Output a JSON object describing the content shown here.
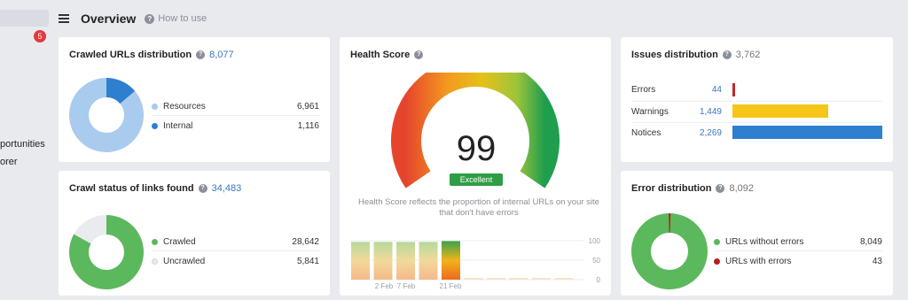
{
  "sidebar": {
    "badge": "5",
    "items": [
      {
        "label": "portunities"
      },
      {
        "label": "orer"
      }
    ]
  },
  "header": {
    "title": "Overview",
    "help_label": "How to use"
  },
  "crawled_urls": {
    "title": "Crawled URLs distribution",
    "count": "8,077",
    "legend": [
      {
        "label": "Resources",
        "value": "6,961",
        "color": "#a9cbee"
      },
      {
        "label": "Internal",
        "value": "1,116",
        "color": "#2f7fd1"
      }
    ]
  },
  "crawl_status": {
    "title": "Crawl status of links found",
    "count": "34,483",
    "legend": [
      {
        "label": "Crawled",
        "value": "28,642",
        "color": "#5cb85c"
      },
      {
        "label": "Uncrawled",
        "value": "5,841",
        "color": "#e9ebee"
      }
    ]
  },
  "health_score": {
    "title": "Health Score",
    "score": "99",
    "badge": "Excellent",
    "description": "Health Score reflects the proportion of internal URLs on your site that don't have errors",
    "history": {
      "y_ticks": [
        "100",
        "50",
        "0"
      ],
      "x_labels": [
        "2 Feb",
        "7 Feb",
        "21 Feb"
      ],
      "bars": [
        97,
        97,
        97,
        97,
        99
      ]
    }
  },
  "issues": {
    "title": "Issues distribution",
    "count": "3,762",
    "rows": [
      {
        "label": "Errors",
        "value": "44",
        "num": 44,
        "color": "#c62828"
      },
      {
        "label": "Warnings",
        "value": "1,449",
        "num": 1449,
        "color": "#f5c518"
      },
      {
        "label": "Notices",
        "value": "2,269",
        "num": 2269,
        "color": "#2f7fd1"
      }
    ]
  },
  "errors": {
    "title": "Error distribution",
    "count": "8,092",
    "legend": [
      {
        "label": "URLs without errors",
        "value": "8,049",
        "color": "#5cb85c"
      },
      {
        "label": "URLs with errors",
        "value": "43",
        "color": "#b71c1c"
      }
    ]
  }
}
